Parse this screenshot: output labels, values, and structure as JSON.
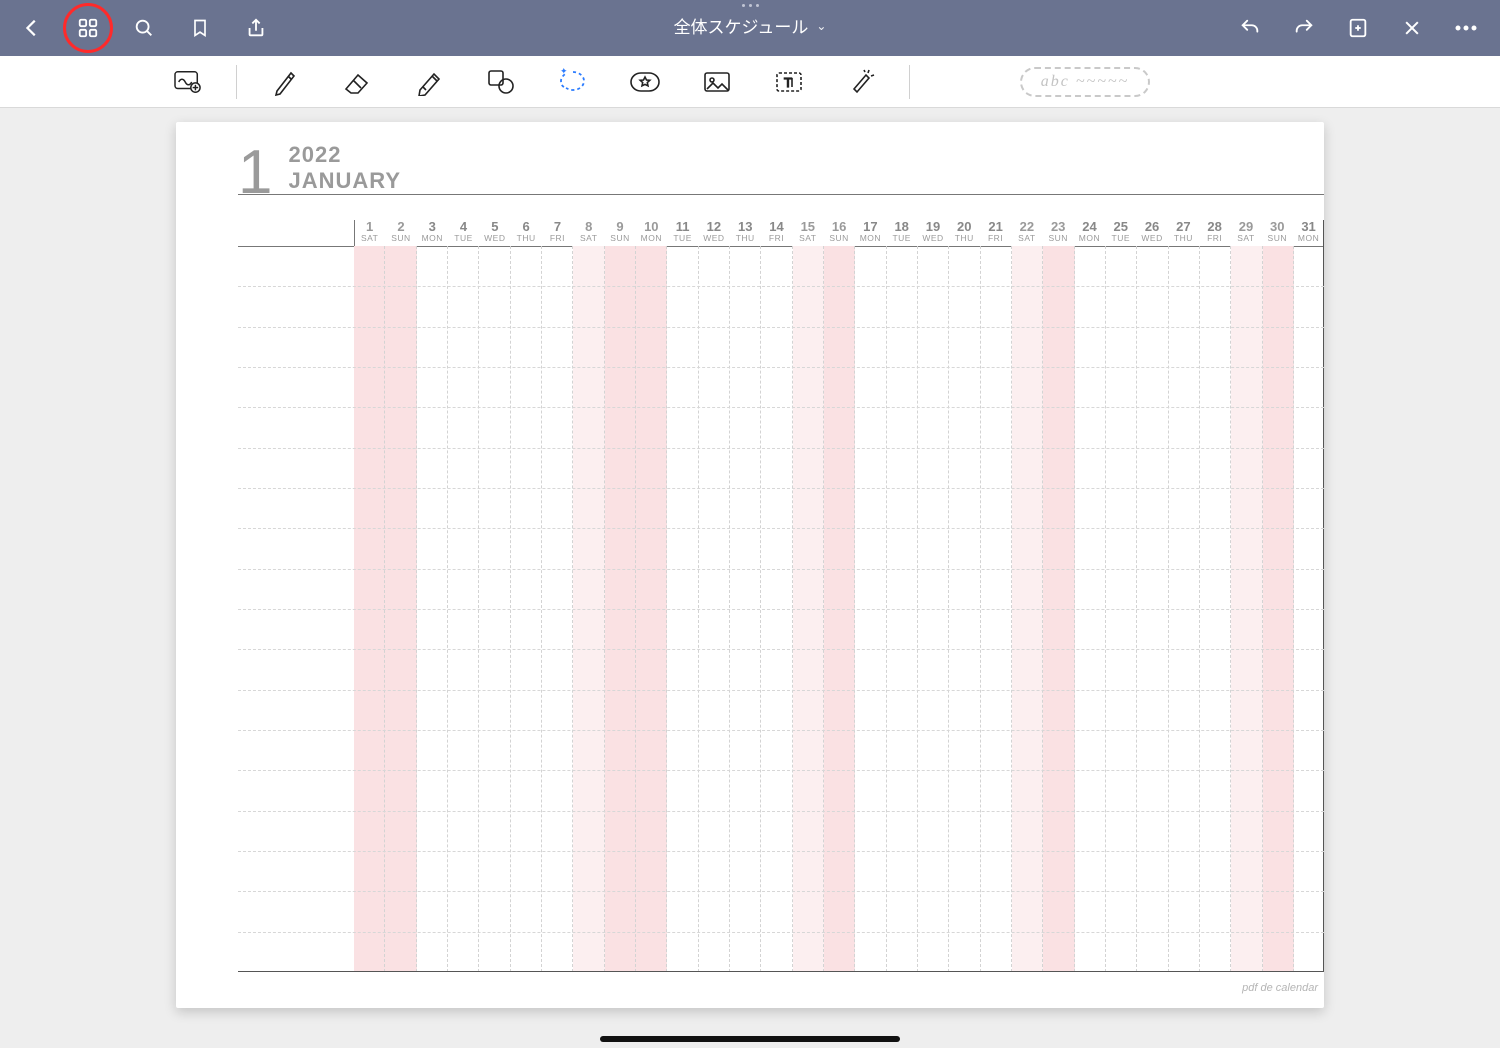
{
  "app": {
    "document_title": "全体スケジュール"
  },
  "favorites": {
    "placeholder": "abc ~~~~~"
  },
  "calendar": {
    "year": "2022",
    "month_number": "1",
    "month_name": "JANUARY",
    "footer": "pdf de calendar",
    "days": [
      {
        "num": "1",
        "dow": "SAT",
        "cls": "pink"
      },
      {
        "num": "2",
        "dow": "SUN",
        "cls": "pink"
      },
      {
        "num": "3",
        "dow": "MON",
        "cls": ""
      },
      {
        "num": "4",
        "dow": "TUE",
        "cls": ""
      },
      {
        "num": "5",
        "dow": "WED",
        "cls": ""
      },
      {
        "num": "6",
        "dow": "THU",
        "cls": ""
      },
      {
        "num": "7",
        "dow": "FRI",
        "cls": ""
      },
      {
        "num": "8",
        "dow": "SAT",
        "cls": "lpink"
      },
      {
        "num": "9",
        "dow": "SUN",
        "cls": "pink"
      },
      {
        "num": "10",
        "dow": "MON",
        "cls": "pink"
      },
      {
        "num": "11",
        "dow": "TUE",
        "cls": ""
      },
      {
        "num": "12",
        "dow": "WED",
        "cls": ""
      },
      {
        "num": "13",
        "dow": "THU",
        "cls": ""
      },
      {
        "num": "14",
        "dow": "FRI",
        "cls": ""
      },
      {
        "num": "15",
        "dow": "SAT",
        "cls": "lpink"
      },
      {
        "num": "16",
        "dow": "SUN",
        "cls": "pink"
      },
      {
        "num": "17",
        "dow": "MON",
        "cls": ""
      },
      {
        "num": "18",
        "dow": "TUE",
        "cls": ""
      },
      {
        "num": "19",
        "dow": "WED",
        "cls": ""
      },
      {
        "num": "20",
        "dow": "THU",
        "cls": ""
      },
      {
        "num": "21",
        "dow": "FRI",
        "cls": ""
      },
      {
        "num": "22",
        "dow": "SAT",
        "cls": "lpink"
      },
      {
        "num": "23",
        "dow": "SUN",
        "cls": "pink"
      },
      {
        "num": "24",
        "dow": "MON",
        "cls": ""
      },
      {
        "num": "25",
        "dow": "TUE",
        "cls": ""
      },
      {
        "num": "26",
        "dow": "WED",
        "cls": ""
      },
      {
        "num": "27",
        "dow": "THU",
        "cls": ""
      },
      {
        "num": "28",
        "dow": "FRI",
        "cls": ""
      },
      {
        "num": "29",
        "dow": "SAT",
        "cls": "lpink"
      },
      {
        "num": "30",
        "dow": "SUN",
        "cls": "pink"
      },
      {
        "num": "31",
        "dow": "MON",
        "cls": ""
      }
    ],
    "row_count": 18
  }
}
